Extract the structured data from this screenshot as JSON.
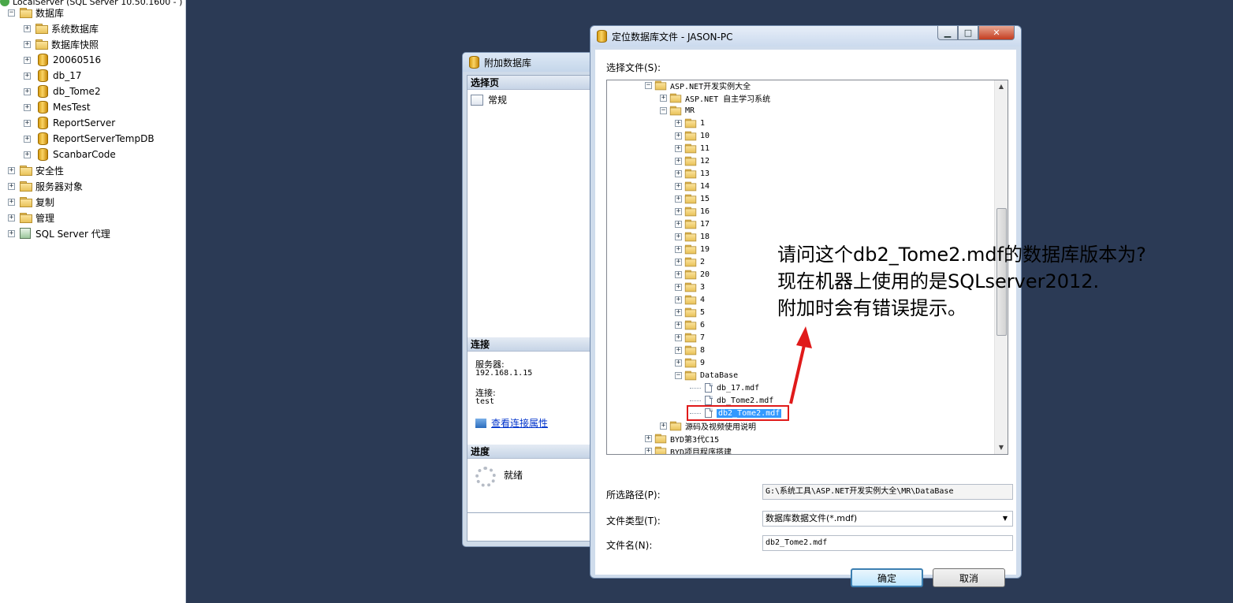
{
  "explorer": {
    "top_node": "LocalServer (SQL Server 10.50.1600 - )",
    "items": [
      {
        "label": "数据库",
        "kind": "folder",
        "level": 0,
        "expander": "−"
      },
      {
        "label": "系统数据库",
        "kind": "folder",
        "level": 1,
        "expander": "+"
      },
      {
        "label": "数据库快照",
        "kind": "folder",
        "level": 1,
        "expander": "+"
      },
      {
        "label": "20060516",
        "kind": "db",
        "level": 1,
        "expander": "+"
      },
      {
        "label": "db_17",
        "kind": "db",
        "level": 1,
        "expander": "+"
      },
      {
        "label": "db_Tome2",
        "kind": "db",
        "level": 1,
        "expander": "+"
      },
      {
        "label": "MesTest",
        "kind": "db",
        "level": 1,
        "expander": "+"
      },
      {
        "label": "ReportServer",
        "kind": "db",
        "level": 1,
        "expander": "+"
      },
      {
        "label": "ReportServerTempDB",
        "kind": "db",
        "level": 1,
        "expander": "+"
      },
      {
        "label": "ScanbarCode",
        "kind": "db",
        "level": 1,
        "expander": "+"
      },
      {
        "label": "安全性",
        "kind": "folder",
        "level": 0,
        "expander": "+"
      },
      {
        "label": "服务器对象",
        "kind": "folder",
        "level": 0,
        "expander": "+"
      },
      {
        "label": "复制",
        "kind": "folder",
        "level": 0,
        "expander": "+"
      },
      {
        "label": "管理",
        "kind": "folder",
        "level": 0,
        "expander": "+"
      },
      {
        "label": "SQL Server 代理",
        "kind": "agent",
        "level": 0,
        "expander": "+"
      }
    ]
  },
  "attach_dialog": {
    "title": "附加数据库",
    "select_page": "选择页",
    "general": "常规",
    "connection": "连接",
    "server_label": "服务器:",
    "server_value": "192.168.1.15",
    "conn_label": "连接:",
    "conn_value": "test",
    "view_props": "查看连接属性",
    "progress": "进度",
    "status": "就绪"
  },
  "locate_dialog": {
    "title": "定位数据库文件 - JASON-PC",
    "select_file_label": "选择文件(S):",
    "tree": [
      {
        "label": "ASP.NET开发实例大全",
        "level": 2,
        "type": "folder",
        "expander": "−"
      },
      {
        "label": "ASP.NET 自主学习系统",
        "level": 3,
        "type": "folder",
        "expander": "+"
      },
      {
        "label": "MR",
        "level": 3,
        "type": "folder",
        "expander": "−"
      },
      {
        "label": "1",
        "level": 4,
        "type": "folder",
        "expander": "+"
      },
      {
        "label": "10",
        "level": 4,
        "type": "folder",
        "expander": "+"
      },
      {
        "label": "11",
        "level": 4,
        "type": "folder",
        "expander": "+"
      },
      {
        "label": "12",
        "level": 4,
        "type": "folder",
        "expander": "+"
      },
      {
        "label": "13",
        "level": 4,
        "type": "folder",
        "expander": "+"
      },
      {
        "label": "14",
        "level": 4,
        "type": "folder",
        "expander": "+"
      },
      {
        "label": "15",
        "level": 4,
        "type": "folder",
        "expander": "+"
      },
      {
        "label": "16",
        "level": 4,
        "type": "folder",
        "expander": "+"
      },
      {
        "label": "17",
        "level": 4,
        "type": "folder",
        "expander": "+"
      },
      {
        "label": "18",
        "level": 4,
        "type": "folder",
        "expander": "+"
      },
      {
        "label": "19",
        "level": 4,
        "type": "folder",
        "expander": "+"
      },
      {
        "label": "2",
        "level": 4,
        "type": "folder",
        "expander": "+"
      },
      {
        "label": "20",
        "level": 4,
        "type": "folder",
        "expander": "+"
      },
      {
        "label": "3",
        "level": 4,
        "type": "folder",
        "expander": "+"
      },
      {
        "label": "4",
        "level": 4,
        "type": "folder",
        "expander": "+"
      },
      {
        "label": "5",
        "level": 4,
        "type": "folder",
        "expander": "+"
      },
      {
        "label": "6",
        "level": 4,
        "type": "folder",
        "expander": "+"
      },
      {
        "label": "7",
        "level": 4,
        "type": "folder",
        "expander": "+"
      },
      {
        "label": "8",
        "level": 4,
        "type": "folder",
        "expander": "+"
      },
      {
        "label": "9",
        "level": 4,
        "type": "folder",
        "expander": "+"
      },
      {
        "label": "DataBase",
        "level": 4,
        "type": "folder",
        "expander": "−"
      },
      {
        "label": "db_17.mdf",
        "level": 5,
        "type": "file",
        "expander": ""
      },
      {
        "label": "db_Tome2.mdf",
        "level": 5,
        "type": "file",
        "expander": ""
      },
      {
        "label": "db2_Tome2.mdf",
        "level": 5,
        "type": "file",
        "expander": "",
        "selected": true
      },
      {
        "label": "源码及视频使用说明",
        "level": 3,
        "type": "folder",
        "expander": "+"
      },
      {
        "label": "BYD第3代C15",
        "level": 2,
        "type": "folder",
        "expander": "+"
      },
      {
        "label": "BYD项目程序搭建",
        "level": 2,
        "type": "folder",
        "expander": "+"
      }
    ],
    "selected_path_label": "所选路径(P):",
    "selected_path_value": "G:\\系统工具\\ASP.NET开发实例大全\\MR\\DataBase",
    "file_type_label": "文件类型(T):",
    "file_type_value": "数据库数据文件(*.mdf)",
    "file_name_label": "文件名(N):",
    "file_name_value": "db2_Tome2.mdf",
    "ok": "确定",
    "cancel": "取消"
  },
  "annotation": {
    "line1": "请问这个db2_Tome2.mdf的数据库版本为?",
    "line2": "现在机器上使用的是SQLserver2012.",
    "line3": "附加时会有错误提示。",
    "color": "#e01a1a"
  }
}
